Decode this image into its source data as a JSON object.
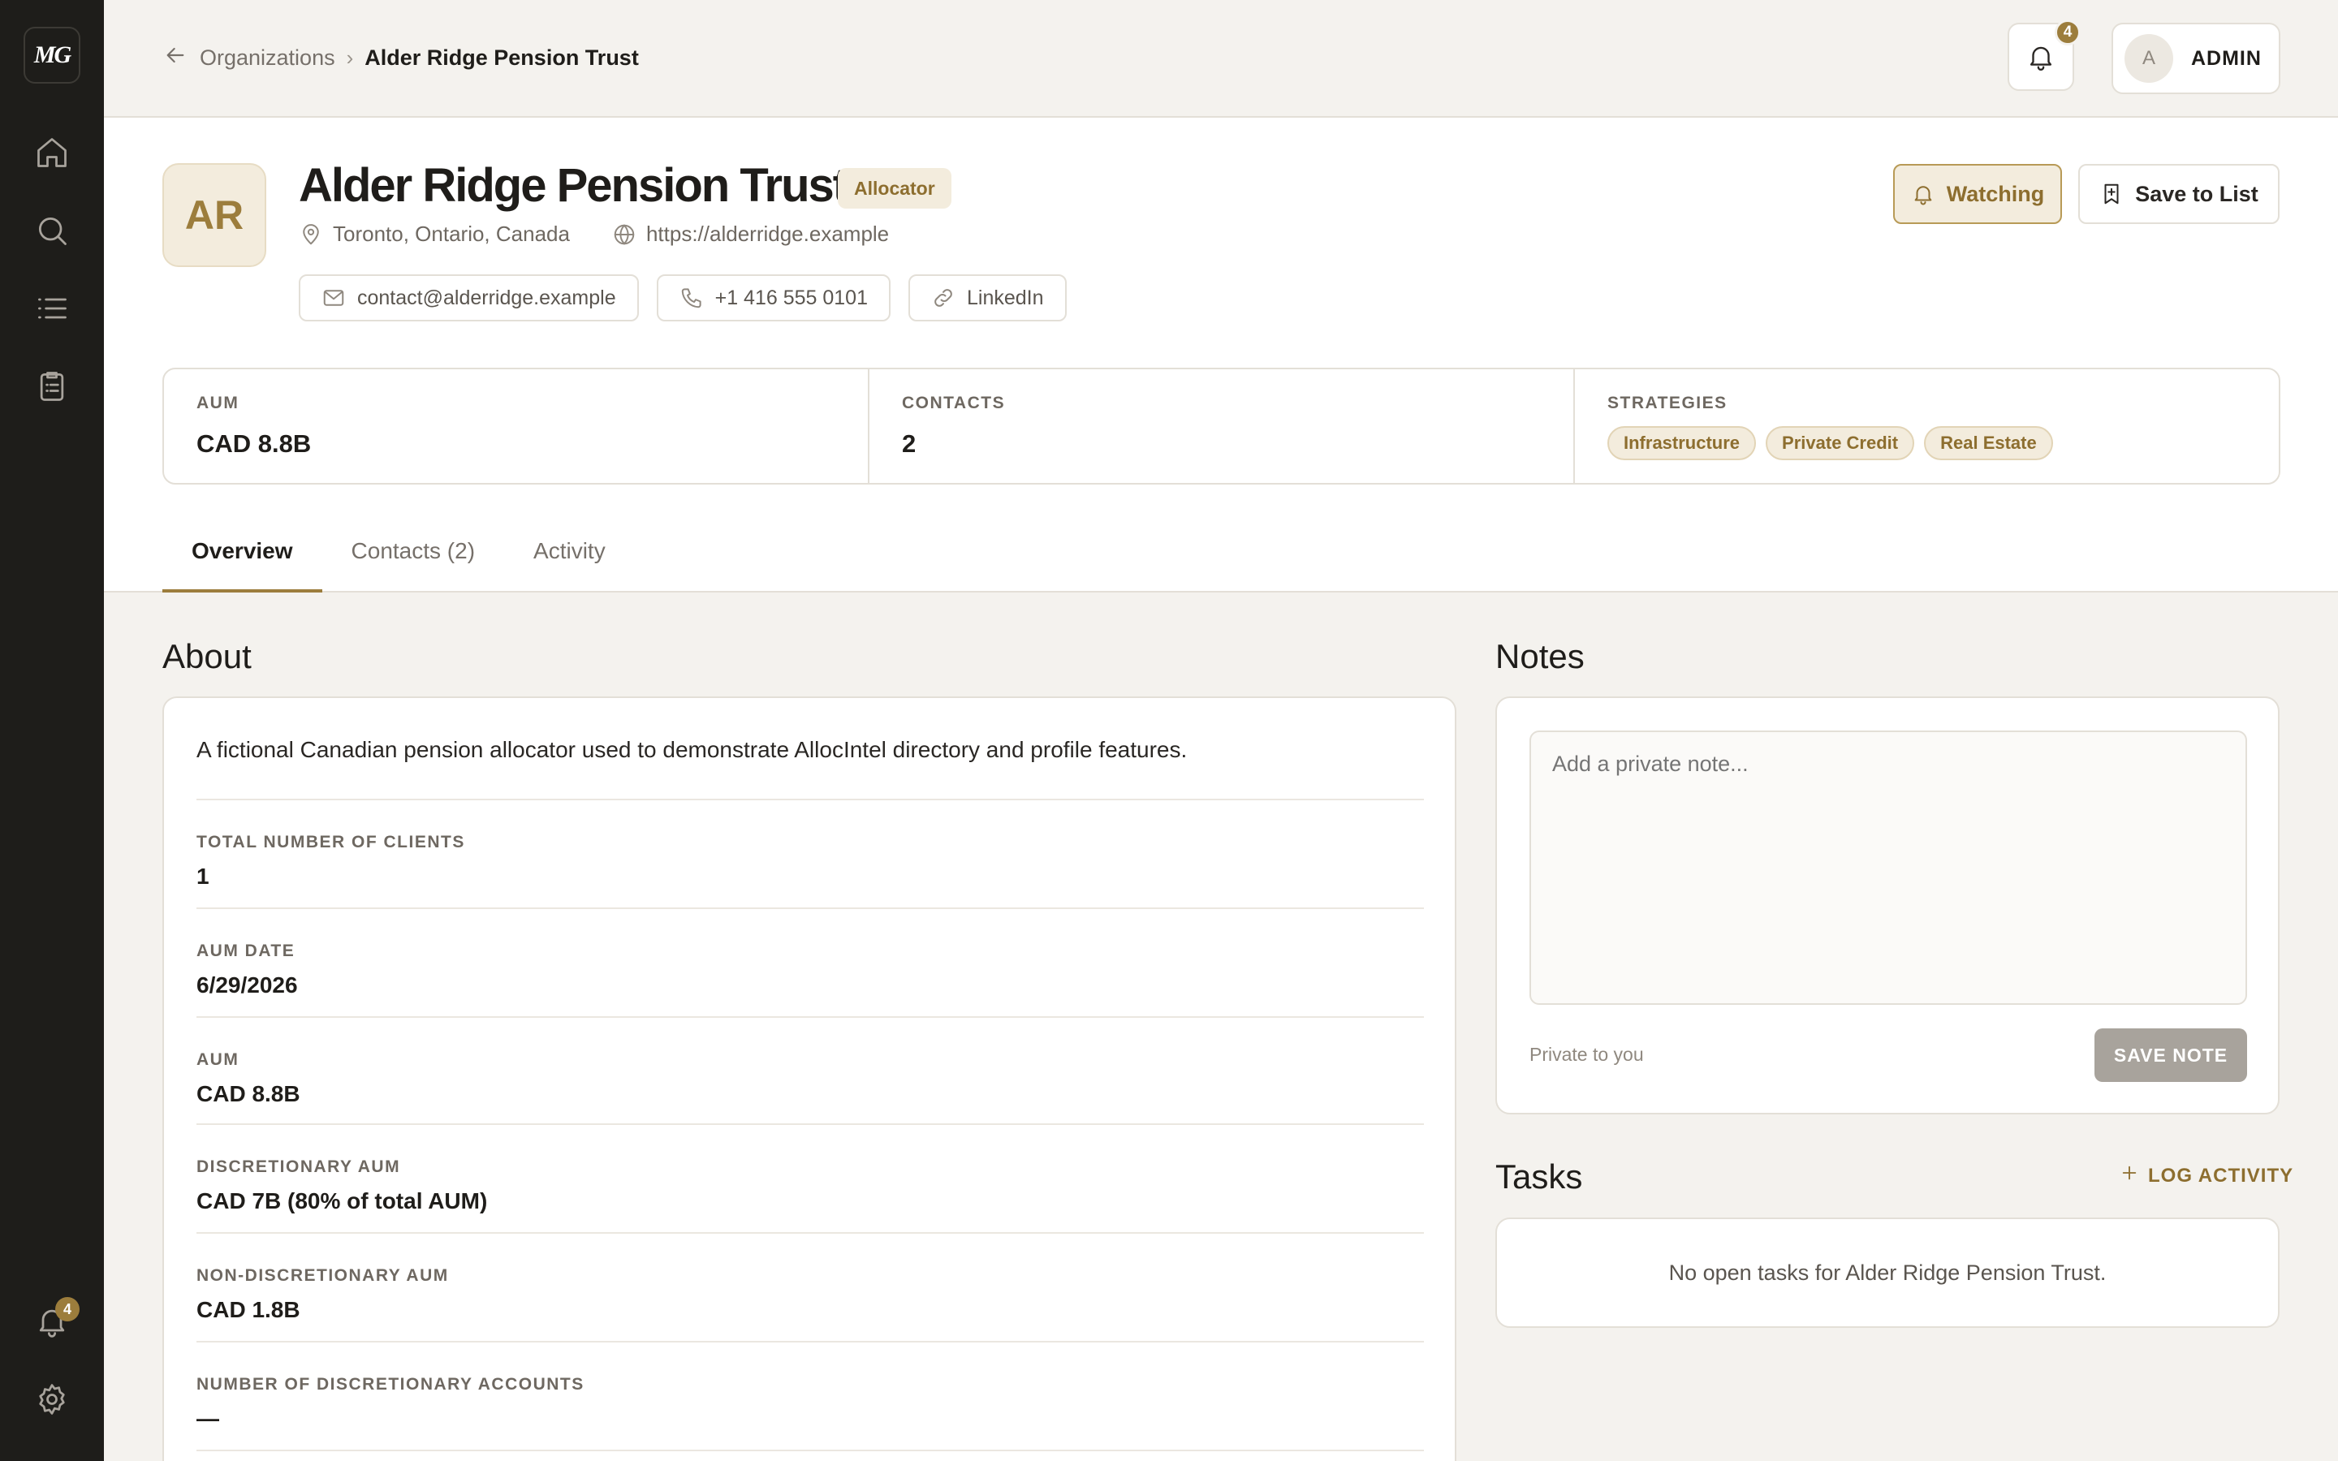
{
  "sidebar": {
    "logo_text": "MG",
    "notification_count": "4",
    "icons": [
      "home-icon",
      "search-icon",
      "list-icon",
      "clipboard-icon",
      "bell-icon",
      "gear-icon"
    ]
  },
  "topbar": {
    "breadcrumb_parent": "Organizations",
    "breadcrumb_separator": "›",
    "breadcrumb_current": "Alder Ridge Pension Trust",
    "notification_count": "4",
    "user_initial": "A",
    "user_name": "ADMIN"
  },
  "org": {
    "initials": "AR",
    "name": "Alder Ridge Pension Trust",
    "type": "Allocator",
    "location": "Toronto, Ontario, Canada",
    "website": "https://alderridge.example",
    "email": "contact@alderridge.example",
    "phone": "+1 416 555 0101",
    "linkedin": "LinkedIn",
    "watch_label": "Watching",
    "save_label": "Save to List"
  },
  "stats": {
    "aum_label": "AUM",
    "aum_value": "CAD 8.8B",
    "contacts_label": "CONTACTS",
    "contacts_value": "2",
    "strategies_label": "STRATEGIES",
    "strategies": [
      "Infrastructure",
      "Private Credit",
      "Real Estate"
    ]
  },
  "tabs": [
    {
      "label": "Overview",
      "active": true
    },
    {
      "label": "Contacts (2)",
      "active": false
    },
    {
      "label": "Activity",
      "active": false
    }
  ],
  "about": {
    "title": "About",
    "description": "A fictional Canadian pension allocator used to demonstrate AllocIntel directory and profile features.",
    "fields": [
      {
        "label": "TOTAL NUMBER OF CLIENTS",
        "value": "1"
      },
      {
        "label": "AUM DATE",
        "value": "6/29/2026"
      },
      {
        "label": "AUM",
        "value": "CAD 8.8B"
      },
      {
        "label": "DISCRETIONARY AUM",
        "value": "CAD 7B (80% of total AUM)"
      },
      {
        "label": "NON-DISCRETIONARY AUM",
        "value": "CAD 1.8B"
      },
      {
        "label": "NUMBER OF DISCRETIONARY ACCOUNTS",
        "value": "—"
      }
    ]
  },
  "notes": {
    "title": "Notes",
    "placeholder": "Add a private note...",
    "privacy_text": "Private to you",
    "save_label": "SAVE NOTE"
  },
  "tasks": {
    "title": "Tasks",
    "log_label": "LOG ACTIVITY",
    "empty_text": "No open tasks for Alder Ridge Pension Trust."
  },
  "colors": {
    "accent": "#9c7d3c",
    "sidebar_bg": "#1e1d1a",
    "page_bg": "#f4f2ee"
  }
}
